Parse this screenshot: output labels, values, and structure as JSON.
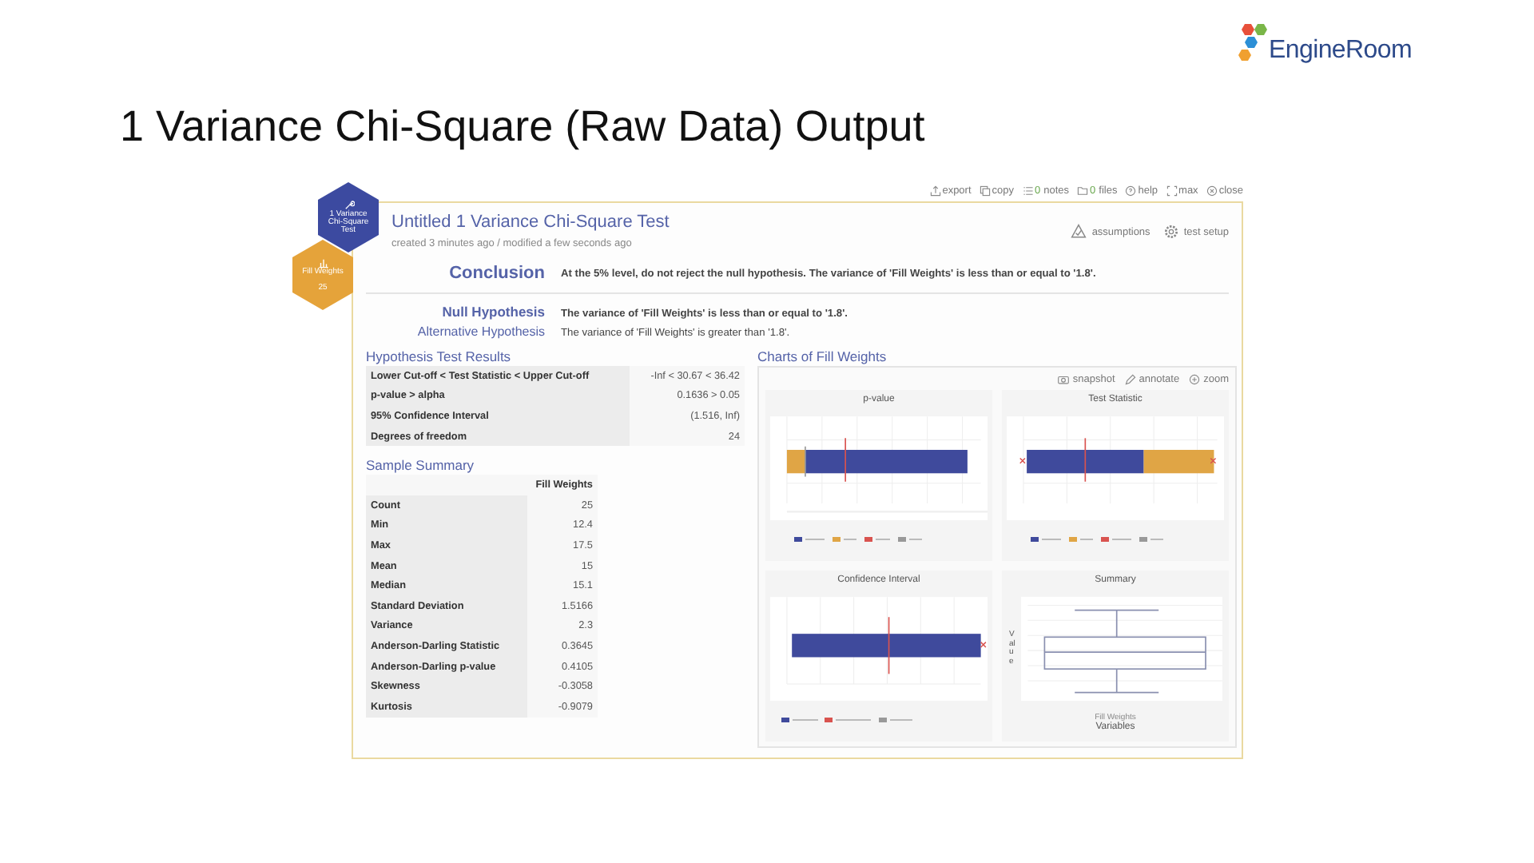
{
  "slide": {
    "title": "1 Variance Chi-Square (Raw Data) Output",
    "logo": "EngineRoom"
  },
  "toolbar": [
    {
      "kind": "export",
      "label": "export"
    },
    {
      "kind": "copy",
      "label": "copy"
    },
    {
      "kind": "notes",
      "count": "0",
      "label": "notes"
    },
    {
      "kind": "files",
      "count": "0",
      "label": "files"
    },
    {
      "kind": "help",
      "label": "help"
    },
    {
      "kind": "max",
      "label": "max"
    },
    {
      "kind": "close",
      "label": "close"
    }
  ],
  "badges": [
    {
      "kind": "test",
      "title": "1 Variance Chi-Square Test"
    },
    {
      "kind": "data",
      "title": "Fill Weights",
      "count": "25"
    }
  ],
  "test": {
    "title": "Untitled 1 Variance Chi-Square Test",
    "meta": "created 3 minutes ago / modified a few seconds ago",
    "actions": [
      {
        "kind": "assumptions",
        "label": "assumptions"
      },
      {
        "kind": "setup",
        "label": "test setup"
      }
    ],
    "conclusion": {
      "label": "Conclusion",
      "text": "At the 5% level, do not reject the null hypothesis. The variance of 'Fill Weights' is less than or equal to '1.8'."
    },
    "hypotheses": [
      {
        "label": "Null Hypothesis",
        "text": "The variance of 'Fill Weights' is less than or equal to '1.8'.",
        "emphasis": true
      },
      {
        "label": "Alternative Hypothesis",
        "text": "The variance of 'Fill Weights' is greater than '1.8'.",
        "emphasis": false
      }
    ]
  },
  "results": {
    "title": "Hypothesis Test Results",
    "rows": [
      [
        "Lower Cut-off < Test Statistic < Upper Cut-off",
        "-Inf < 30.67 < 36.42"
      ],
      [
        "p-value > alpha",
        "0.1636 > 0.05"
      ],
      [
        "95% Confidence Interval",
        "(1.516, Inf)"
      ],
      [
        "Degrees of freedom",
        "24"
      ]
    ]
  },
  "summary": {
    "title": "Sample Summary",
    "column": "Fill Weights",
    "rows": [
      [
        "Count",
        "25"
      ],
      [
        "Min",
        "12.4"
      ],
      [
        "Max",
        "17.5"
      ],
      [
        "Mean",
        "15"
      ],
      [
        "Median",
        "15.1"
      ],
      [
        "Standard Deviation",
        "1.5166"
      ],
      [
        "Variance",
        "2.3"
      ],
      [
        "Anderson-Darling Statistic",
        "0.3645"
      ],
      [
        "Anderson-Darling p-value",
        "0.4105"
      ],
      [
        "Skewness",
        "-0.3058"
      ],
      [
        "Kurtosis",
        "-0.9079"
      ]
    ]
  },
  "charts": {
    "title": "Charts of Fill Weights",
    "tools": [
      {
        "kind": "snapshot",
        "label": "snapshot"
      },
      {
        "kind": "annotate",
        "label": "annotate"
      },
      {
        "kind": "zoom",
        "label": "zoom"
      }
    ],
    "panels": [
      {
        "kind": "pvalue",
        "title": "p-value"
      },
      {
        "kind": "statistic",
        "title": "Test Statistic"
      },
      {
        "kind": "interval",
        "title": "Confidence Interval"
      },
      {
        "kind": "box",
        "title": "Summary",
        "ylabel": "Value",
        "category": "Fill Weights",
        "xlabel": "Variables"
      }
    ]
  }
}
